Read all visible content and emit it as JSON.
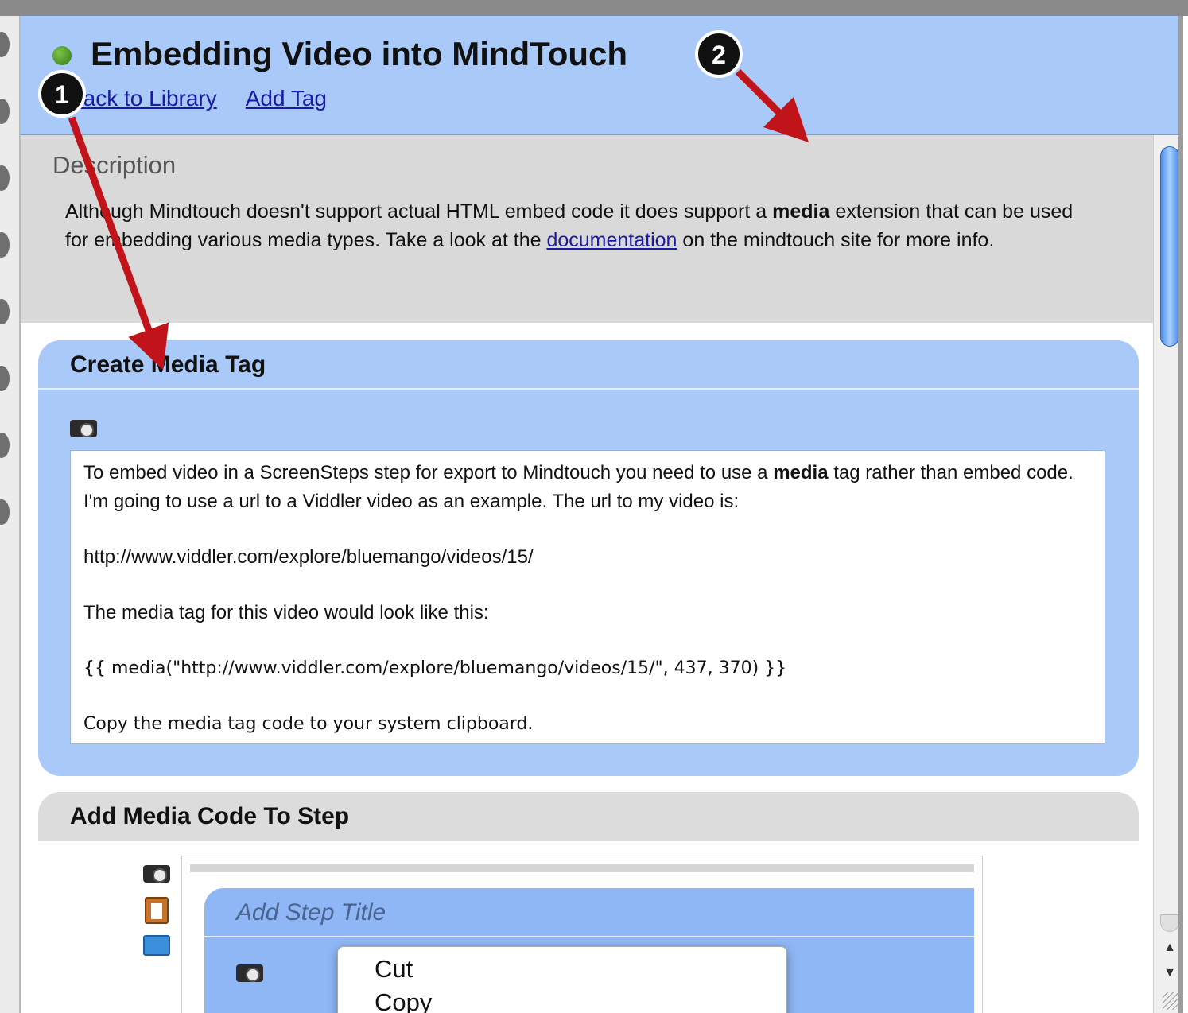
{
  "page": {
    "title": "Embedding Video into MindTouch",
    "links": {
      "back": "Back to Library",
      "add_tag": "Add Tag"
    }
  },
  "description": {
    "heading": "Description",
    "text_before_bold": "Although Mindtouch doesn't support actual HTML embed code it does support a ",
    "bold": "media",
    "text_after_bold": " extension that can be used for embedding various media types. Take a look at the ",
    "link": "documentation",
    "text_after_link": " on the mindtouch site for more info."
  },
  "step1": {
    "title": "Create Media Tag",
    "para1_before": "To embed video in a ScreenSteps step for export to Mindtouch you need to use a ",
    "para1_bold": "media",
    "para1_after": " tag rather than embed code. I'm going to use a url to a Viddler video as an example. The url to my video is:",
    "url": "http://www.viddler.com/explore/bluemango/videos/15/",
    "para2": "The media tag for this video would look like this:",
    "code": "{{ media(\"http://www.viddler.com/explore/bluemango/videos/15/\", 437, 370) }}",
    "para3": "Copy the media tag code to your system clipboard."
  },
  "step2": {
    "title": "Add Media Code To Step",
    "inner_step_title_placeholder": "Add Step Title"
  },
  "context_menu": {
    "items": [
      "Cut",
      "Copy"
    ]
  },
  "annotations": {
    "badge1": "1",
    "badge2": "2",
    "arrow_color": "#c0141a"
  },
  "colors": {
    "header_bg": "#a9c9f8",
    "description_bg": "#d9d9d9",
    "step_active_bg": "#a9c9f8",
    "step_inactive_bg": "#dcdcdc",
    "link": "#1a1aa6",
    "status_dot": "#3f8c1c"
  },
  "icons": [
    "status-dot-icon",
    "camera-icon",
    "clipboard-icon",
    "folder-icon",
    "scroll-up-arrow-icon",
    "scroll-down-arrow-icon",
    "resize-grip-icon"
  ]
}
